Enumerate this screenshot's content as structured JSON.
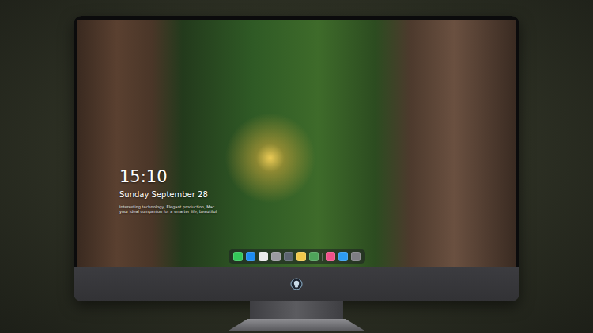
{
  "lock_screen": {
    "time": "15:10",
    "date": "Sunday September 28",
    "tagline": [
      "Interesting technology, Elegant production, Mac",
      "your ideal companion for a smarter life, beautiful"
    ]
  },
  "dock": {
    "items": [
      {
        "kind": "app",
        "color": "#34c759"
      },
      {
        "kind": "app",
        "color": "#1e8cf0"
      },
      {
        "kind": "app",
        "color": "#e9e9ea"
      },
      {
        "kind": "app",
        "color": "#9a9aa0"
      },
      {
        "kind": "app",
        "color": "#5b6470"
      },
      {
        "kind": "app",
        "color": "#f2c94c"
      },
      {
        "kind": "app",
        "color": "#4fa35a"
      },
      {
        "kind": "separator",
        "color": "#8a8a8a"
      },
      {
        "kind": "app",
        "color": "#f0508a"
      },
      {
        "kind": "app",
        "color": "#2d9cf0"
      },
      {
        "kind": "app",
        "color": "#7d7d82"
      }
    ]
  }
}
